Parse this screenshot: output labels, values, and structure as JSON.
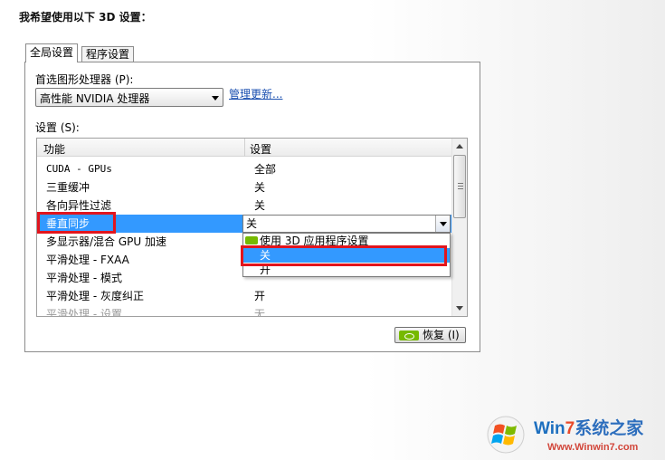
{
  "heading": "我希望使用以下 3D 设置：",
  "tabs": [
    {
      "label": "全局设置",
      "active": true
    },
    {
      "label": "程序设置",
      "active": false
    }
  ],
  "gpu": {
    "label": "首选图形处理器 (P):",
    "value": "高性能 NVIDIA 处理器",
    "manage_link": "管理更新..."
  },
  "settings": {
    "label": "设置 (S):",
    "columns": [
      "功能",
      "设置"
    ],
    "rows": [
      {
        "feature": "CUDA - GPUs",
        "value": "全部"
      },
      {
        "feature": "三重缓冲",
        "value": "关"
      },
      {
        "feature": "各向异性过滤",
        "value": "关"
      },
      {
        "feature": "垂直同步",
        "value": "关",
        "selected": true
      },
      {
        "feature": "多显示器/混合 GPU 加速",
        "value": ""
      },
      {
        "feature": "平滑处理 - FXAA",
        "value": ""
      },
      {
        "feature": "平滑处理 - 模式",
        "value": ""
      },
      {
        "feature": "平滑处理 - 灰度纠正",
        "value": "开"
      },
      {
        "feature": "平滑处理 - 设置",
        "value": "无",
        "faded": true
      }
    ]
  },
  "dropdown": {
    "current": "关",
    "options": [
      {
        "label": "使用 3D 应用程序设置",
        "icon": "nvidia-icon"
      },
      {
        "label": "关",
        "highlighted": true
      },
      {
        "label": "开"
      }
    ]
  },
  "restore_button": "恢复 (I)",
  "watermark": {
    "title_prefix": "Win",
    "title_seven": "7",
    "title_rest": "系统之家",
    "url": "Www.Winwin7.com"
  },
  "colors": {
    "selection": "#3399ff",
    "highlight_box": "#e2151d",
    "nvidia_green": "#76b900",
    "link": "#1a4fb0"
  }
}
